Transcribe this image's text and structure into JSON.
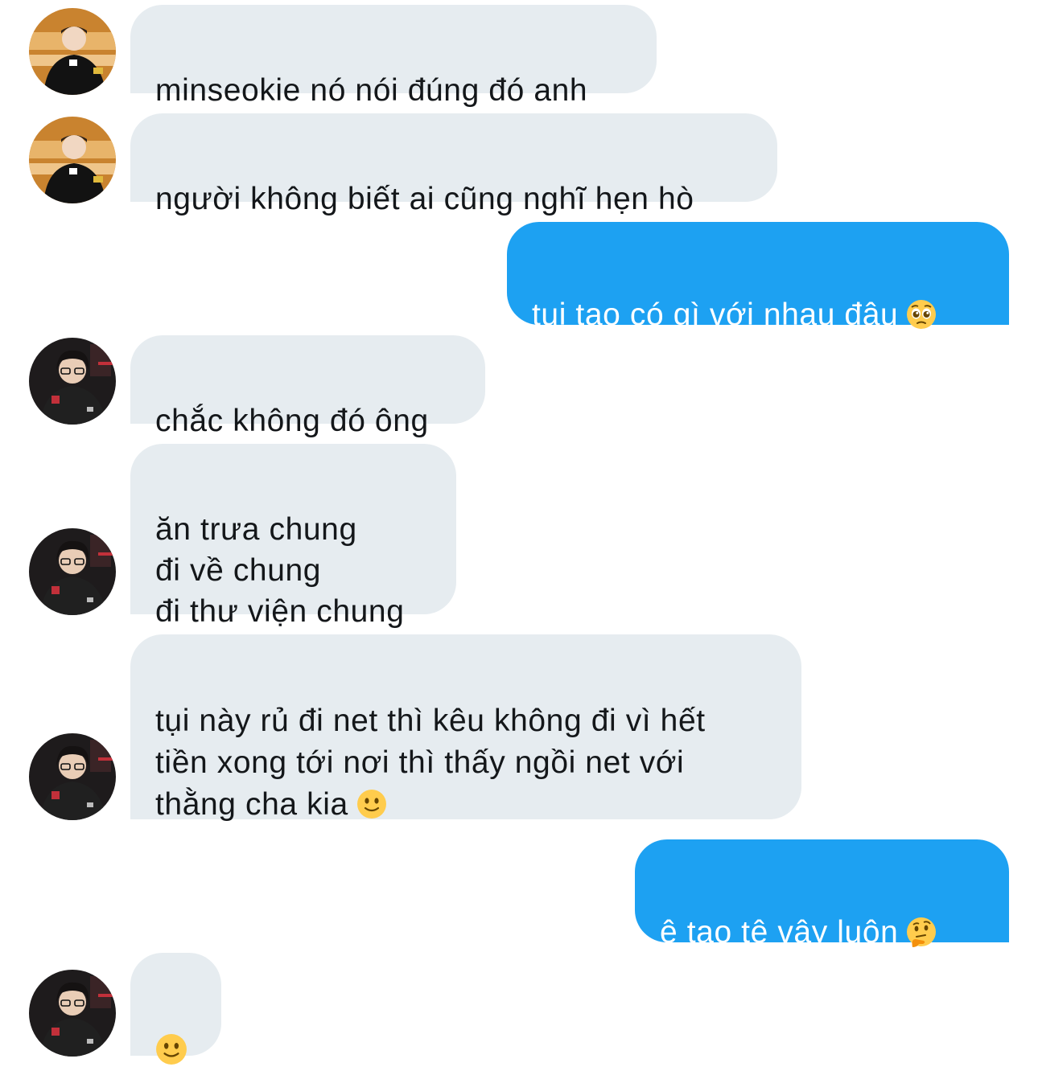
{
  "conversation": {
    "messages": [
      {
        "direction": "incoming",
        "avatar": "contact-a",
        "text": "minseokie nó nói đúng đó anh"
      },
      {
        "direction": "incoming",
        "avatar": "contact-a",
        "text": "người không biết ai cũng nghĩ hẹn hò"
      },
      {
        "direction": "outgoing",
        "text": "tụi tao có gì với nhau đâu",
        "emoji": "pleading-face-icon"
      },
      {
        "direction": "incoming",
        "avatar": "contact-b",
        "text": "chắc không đó ông"
      },
      {
        "direction": "incoming",
        "avatar": "contact-b",
        "text": "ăn trưa chung\nđi về chung\nđi thư viện chung"
      },
      {
        "direction": "incoming",
        "avatar": "contact-b",
        "text": "tụi này rủ đi net thì kêu không đi vì hết\ntiền xong tới nơi thì thấy ngồi net với\nthằng cha kia",
        "emoji": "slightly-smiling-face-icon"
      },
      {
        "direction": "outgoing",
        "text": "ê tao tệ vậy luôn",
        "emoji": "thinking-face-icon"
      },
      {
        "direction": "incoming",
        "avatar": "contact-b",
        "text": "",
        "emoji": "slightly-smiling-face-icon"
      }
    ]
  },
  "colors": {
    "incoming_bubble": "#e6ecf0",
    "incoming_text": "#14171a",
    "outgoing_bubble": "#1da1f2",
    "outgoing_text": "#ffffff",
    "background": "#ffffff"
  }
}
